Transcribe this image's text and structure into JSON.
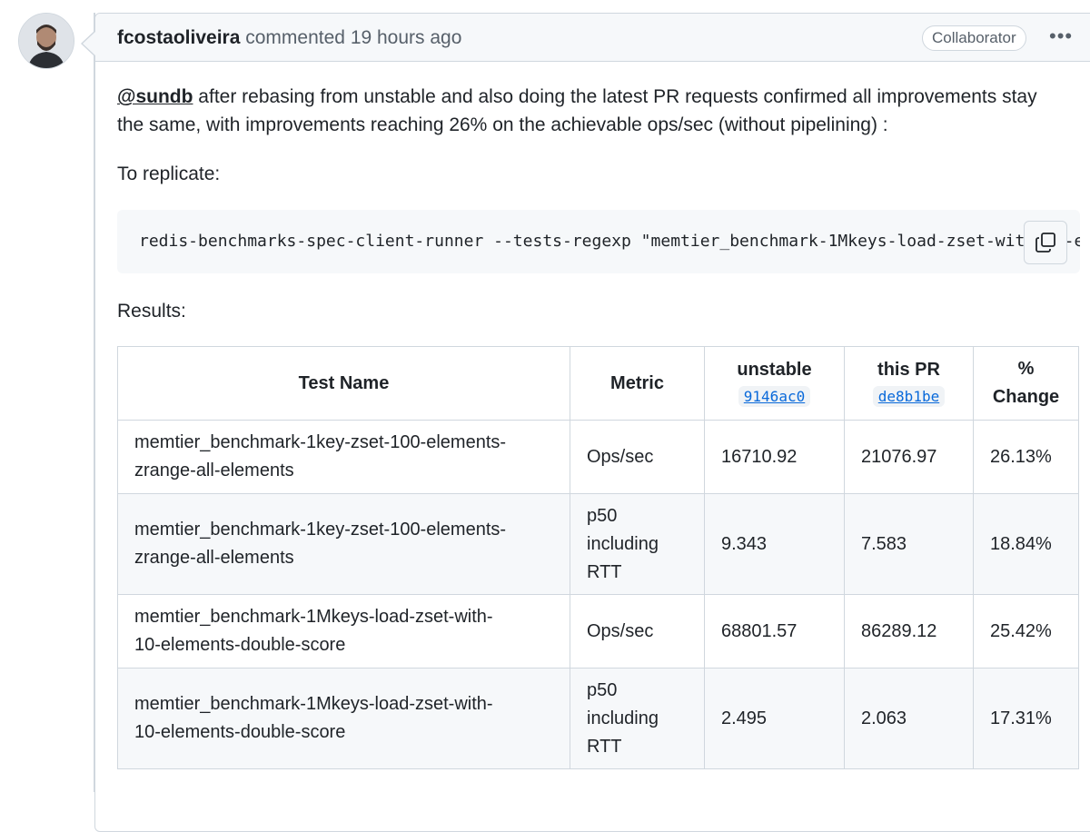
{
  "comment": {
    "author": "fcostaoliveira",
    "action": "commented",
    "time": "19 hours ago",
    "badge": "Collaborator",
    "menu_icon": "kebab-horizontal-icon",
    "mention": "@sundb",
    "paragraph_rest": " after rebasing from unstable and also doing the latest PR requests confirmed all improvements stay",
    "paragraph_line2": "the same, with improvements reaching 26% on the achievable ops/sec (without pipelining) :",
    "replicate_label": "To replicate:",
    "code": "redis-benchmarks-spec-client-runner --tests-regexp \"memtier_benchmark-1Mkeys-load-zset-with-10-e",
    "copy_icon": "copy-icon",
    "results_label": "Results:"
  },
  "table": {
    "headers": {
      "test_name": "Test Name",
      "metric": "Metric",
      "unstable": "unstable",
      "unstable_sha": "9146ac0",
      "this_pr": "this PR",
      "this_pr_sha": "de8b1be",
      "change_line1": "%",
      "change_line2": "Change"
    },
    "rows": [
      {
        "name_l1": "memtier_benchmark-1key-zset-100-elements-",
        "name_l2": "zrange-all-elements",
        "metric_l1": "Ops/sec",
        "metric_l2": "",
        "metric_l3": "",
        "unstable": "16710.92",
        "pr": "21076.97",
        "change": "26.13%"
      },
      {
        "name_l1": "memtier_benchmark-1key-zset-100-elements-",
        "name_l2": "zrange-all-elements",
        "metric_l1": "p50",
        "metric_l2": "including",
        "metric_l3": "RTT",
        "unstable": "9.343",
        "pr": "7.583",
        "change": "18.84%"
      },
      {
        "name_l1": "memtier_benchmark-1Mkeys-load-zset-with-",
        "name_l2": "10-elements-double-score",
        "metric_l1": "Ops/sec",
        "metric_l2": "",
        "metric_l3": "",
        "unstable": "68801.57",
        "pr": "86289.12",
        "change": "25.42%"
      },
      {
        "name_l1": "memtier_benchmark-1Mkeys-load-zset-with-",
        "name_l2": "10-elements-double-score",
        "metric_l1": "p50",
        "metric_l2": "including",
        "metric_l3": "RTT",
        "unstable": "2.495",
        "pr": "2.063",
        "change": "17.31%"
      }
    ]
  }
}
